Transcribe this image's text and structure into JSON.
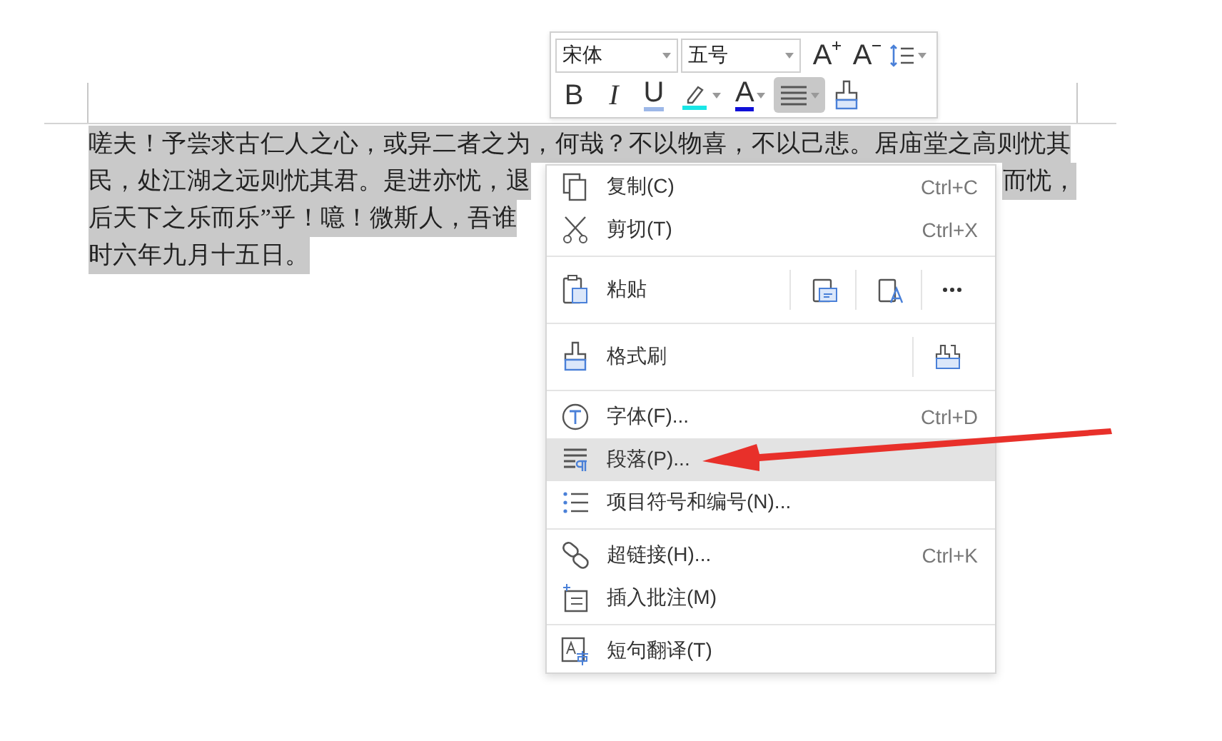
{
  "document": {
    "lines": [
      {
        "segments": [
          "嗟夫！予尝求古仁人之心，或异二者之为，何哉？不以物喜，不以己悲。居庙堂之高则忧其"
        ],
        "highlighted": true
      },
      {
        "segments": [
          "民，处江湖之远则忧其君。是进亦忧，退",
          "而忧，"
        ],
        "highlighted": true
      },
      {
        "segments": [
          "后天下之乐而乐”乎！噫！微斯人，吾谁"
        ],
        "highlighted": true
      },
      {
        "segments": [
          "时六年九月十五日。"
        ],
        "highlighted": true
      }
    ]
  },
  "mini_toolbar": {
    "font_name": "宋体",
    "font_size": "五号",
    "row1_tools": [
      {
        "kind": "grow-font",
        "label": "A",
        "selected": false
      },
      {
        "kind": "shrink-font",
        "label": "A",
        "selected": false
      },
      {
        "kind": "line-spacing",
        "selected": false
      }
    ],
    "row2_tools": [
      {
        "kind": "bold",
        "label": "B",
        "selected": false
      },
      {
        "kind": "italic",
        "label": "I",
        "selected": false
      },
      {
        "kind": "underline",
        "label": "U",
        "selected": false
      },
      {
        "kind": "highlight",
        "selected": false
      },
      {
        "kind": "font-color",
        "label": "A",
        "selected": false
      },
      {
        "kind": "align",
        "selected": true
      },
      {
        "kind": "format-painter",
        "selected": false
      }
    ]
  },
  "context_menu": {
    "groups": [
      [
        {
          "label": "复制(C)",
          "shortcut": "Ctrl+C",
          "highlighted": false
        },
        {
          "label": "剪切(T)",
          "shortcut": "Ctrl+X",
          "highlighted": false
        }
      ],
      [
        {
          "label": "粘贴",
          "highlighted": false
        }
      ],
      [
        {
          "label": "格式刷",
          "highlighted": false
        }
      ],
      [
        {
          "label": "字体(F)...",
          "shortcut": "Ctrl+D",
          "highlighted": false
        },
        {
          "label": "段落(P)...",
          "highlighted": true
        },
        {
          "label": "项目符号和编号(N)...",
          "highlighted": false
        }
      ],
      [
        {
          "label": "超链接(H)...",
          "shortcut": "Ctrl+K",
          "highlighted": false
        },
        {
          "label": "插入批注(M)",
          "highlighted": false
        }
      ],
      [
        {
          "label": "短句翻译(T)",
          "highlighted": false
        }
      ]
    ]
  }
}
